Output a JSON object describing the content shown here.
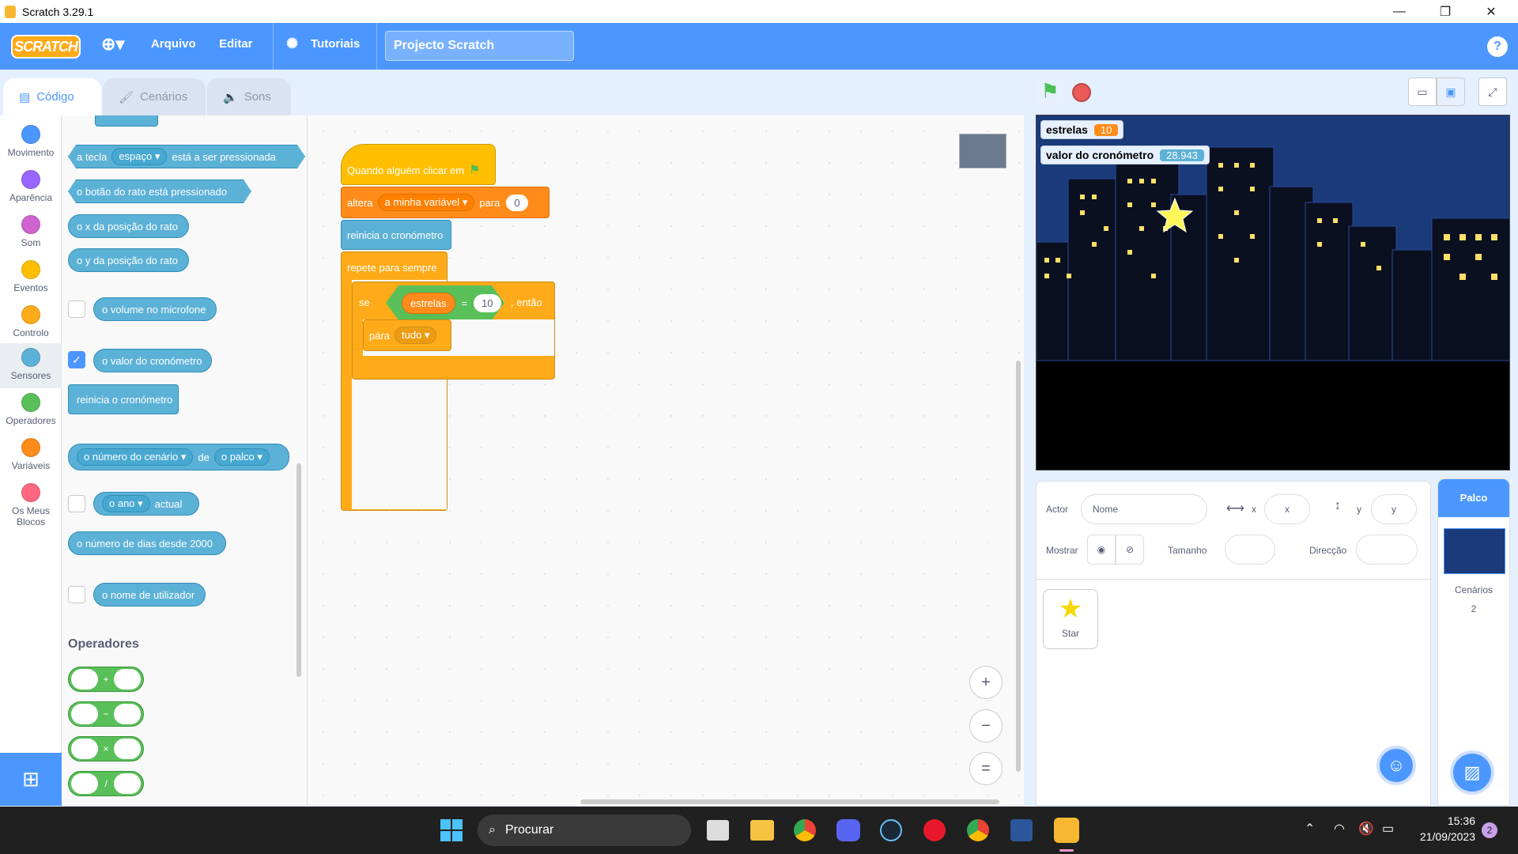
{
  "window": {
    "title": "Scratch 3.29.1"
  },
  "menu": {
    "language_icon": "globe-icon",
    "file": "Arquivo",
    "edit": "Editar",
    "tutorials": "Tutoriais",
    "project_title": "Projecto Scratch",
    "help": "?"
  },
  "tabs": [
    {
      "label": "Código",
      "active": true
    },
    {
      "label": "Cenários"
    },
    {
      "label": "Sons"
    }
  ],
  "categories": [
    {
      "label": "Movimento",
      "color": "#4c97ff"
    },
    {
      "label": "Aparência",
      "color": "#9966ff"
    },
    {
      "label": "Som",
      "color": "#cf63cf"
    },
    {
      "label": "Eventos",
      "color": "#ffbf00"
    },
    {
      "label": "Controlo",
      "color": "#ffab19"
    },
    {
      "label": "Sensores",
      "color": "#5cb1d6"
    },
    {
      "label": "Operadores",
      "color": "#59c059"
    },
    {
      "label": "Variáveis",
      "color": "#ff8c1a"
    },
    {
      "label": "Os Meus Blocos",
      "color": "#ff6680"
    }
  ],
  "palette": {
    "key_pressed": {
      "pre": "a tecla",
      "dd": "espaço",
      "post": "está a ser pressionada"
    },
    "mouse_down": "o botão do rato está pressionado",
    "mouse_x": "o x da posição do rato",
    "mouse_y": "o y da posição do rato",
    "loudness": "o volume no microfone",
    "timer": "o valor do cronómetro",
    "reset_timer": "reinicia o cronómetro",
    "of_block": {
      "dd1": "o número do cenário",
      "mid": "de",
      "dd2": "o palco"
    },
    "current": {
      "dd": "o ano",
      "post": "actual"
    },
    "days_since": "o número de dias desde 2000",
    "username": "o nome de utilizador",
    "operators_heading": "Operadores",
    "op_symbols": [
      "+",
      "−",
      "×",
      "/"
    ]
  },
  "script": {
    "hat": "Quando alguém clicar em",
    "set_var": {
      "pre": "altera",
      "dd": "a minha variável",
      "mid": "para",
      "val": "0"
    },
    "reset_timer": "reinicia o cronómetro",
    "forever": "repete para sempre",
    "if": {
      "pre": "se",
      "var": "estrelas",
      "op": "=",
      "val": "10",
      "post": ", então"
    },
    "stop": {
      "pre": "pára",
      "dd": "tudo"
    }
  },
  "zoom": {
    "in": "+",
    "out": "−",
    "reset": "="
  },
  "stage": {
    "monitors": [
      {
        "label": "estrelas",
        "value": "10"
      },
      {
        "label": "valor do cronómetro",
        "value": "28.943"
      }
    ]
  },
  "sprite_info": {
    "actor_label": "Actor",
    "name_placeholder": "Nome",
    "x_label": "x",
    "x_placeholder": "x",
    "y_label": "y",
    "y_placeholder": "y",
    "show_label": "Mostrar",
    "size_label": "Tamanho",
    "direction_label": "Direcção"
  },
  "sprites": [
    {
      "name": "Star"
    }
  ],
  "stage_panel": {
    "title": "Palco",
    "backdrops_label": "Cenários",
    "backdrops_count": "2"
  },
  "taskbar": {
    "search": "Procurar",
    "time": "15:36",
    "date": "21/09/2023",
    "notifications": "2"
  }
}
